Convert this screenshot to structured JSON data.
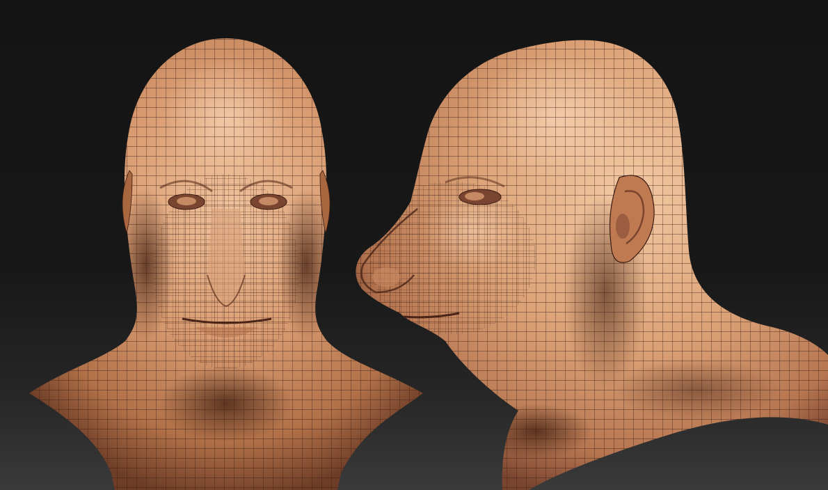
{
  "scene": {
    "background_top": "#141414",
    "background_bottom": "#3a3a3a",
    "skin_light": "#e9b78f",
    "skin_mid": "#c98a62",
    "skin_dark": "#6e3d27",
    "wire_color": "#3a1c12"
  },
  "views": [
    {
      "name": "front-view"
    },
    {
      "name": "side-view"
    }
  ]
}
